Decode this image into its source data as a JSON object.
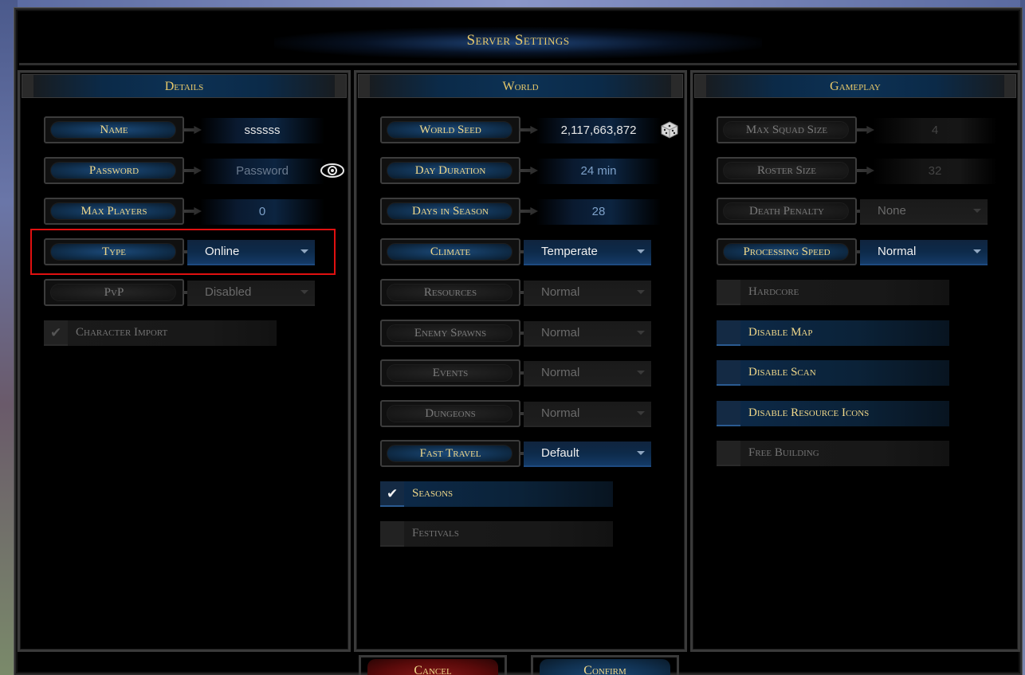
{
  "window": {
    "title": "Server Settings"
  },
  "details": {
    "title": "Details",
    "name_label": "Name",
    "name_value": "ssssss",
    "password_label": "Password",
    "password_placeholder": "Password",
    "max_players_label": "Max Players",
    "max_players_value": "0",
    "type_label": "Type",
    "type_value": "Online",
    "pvp_label": "PvP",
    "pvp_value": "Disabled",
    "character_import_label": "Character Import",
    "character_import_checked": true
  },
  "world": {
    "title": "World",
    "seed_label": "World Seed",
    "seed_value": "2,117,663,872",
    "day_duration_label": "Day Duration",
    "day_duration_value": "24 min",
    "days_in_season_label": "Days in Season",
    "days_in_season_value": "28",
    "climate_label": "Climate",
    "climate_value": "Temperate",
    "resources_label": "Resources",
    "resources_value": "Normal",
    "enemy_spawns_label": "Enemy Spawns",
    "enemy_spawns_value": "Normal",
    "events_label": "Events",
    "events_value": "Normal",
    "dungeons_label": "Dungeons",
    "dungeons_value": "Normal",
    "fast_travel_label": "Fast Travel",
    "fast_travel_value": "Default",
    "seasons_label": "Seasons",
    "seasons_checked": true,
    "festivals_label": "Festivals",
    "festivals_checked": false
  },
  "gameplay": {
    "title": "Gameplay",
    "max_squad_label": "Max Squad Size",
    "max_squad_value": "4",
    "roster_label": "Roster Size",
    "roster_value": "32",
    "death_penalty_label": "Death Penalty",
    "death_penalty_value": "None",
    "processing_speed_label": "Processing Speed",
    "processing_speed_value": "Normal",
    "hardcore_label": "Hardcore",
    "hardcore_checked": false,
    "disable_map_label": "Disable Map",
    "disable_map_checked": false,
    "disable_scan_label": "Disable Scan",
    "disable_scan_checked": false,
    "disable_resource_icons_label": "Disable Resource Icons",
    "disable_resource_icons_checked": false,
    "free_building_label": "Free Building",
    "free_building_checked": false
  },
  "footer": {
    "cancel_label": "Cancel",
    "confirm_label": "Confirm"
  },
  "colors": {
    "gold": "#e8c96a",
    "accent_blue": "#1c4a7a",
    "highlight_red": "#e01010",
    "cancel_red": "#8a1a1a"
  },
  "icons": {
    "reveal_password": "eye-icon",
    "randomize_seed": "dice-icon",
    "checkmark": "checkmark-icon"
  }
}
